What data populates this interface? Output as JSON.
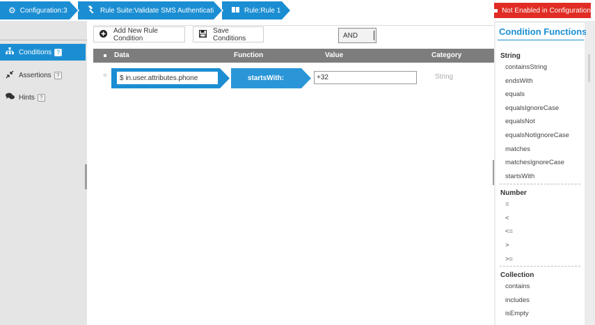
{
  "breadcrumbs": [
    {
      "label": "Configuration:3",
      "icon": "gear-icon"
    },
    {
      "label": "Rule Suite:Validate SMS Authentication",
      "icon": "gavel-icon"
    },
    {
      "label": "Rule:Rule 1",
      "icon": "book-icon"
    }
  ],
  "status_badge": {
    "label": "Not Enabled in Configuration",
    "color": "#e02c24"
  },
  "sidebar": {
    "items": [
      {
        "label": "Conditions",
        "icon": "sitemap-icon",
        "help": "?",
        "active": true
      },
      {
        "label": "Assertions",
        "icon": "compress-icon",
        "help": "?",
        "active": false
      },
      {
        "label": "Hints",
        "icon": "comments-icon",
        "help": "?",
        "active": false
      }
    ]
  },
  "toolbar": {
    "add_label": "Add New Rule Condition",
    "save_label": "Save Conditions",
    "logic_value": "AND"
  },
  "table": {
    "columns": [
      "Data",
      "Function",
      "Value",
      "Category"
    ],
    "rows": [
      {
        "data": "$ in.user.attributes.phone",
        "function": "startsWith:",
        "value": "+32",
        "category": "String"
      }
    ]
  },
  "functions_panel": {
    "title": "Condition Functions",
    "sections": [
      {
        "name": "String",
        "items": [
          "containsString",
          "endsWith",
          "equals",
          "equalsIgnoreCase",
          "equalsNot",
          "equalsNotIgnoreCase",
          "matches",
          "matchesIgnoreCase",
          "startsWith"
        ]
      },
      {
        "name": "Number",
        "items": [
          "=",
          "<",
          "<=",
          ">",
          ">="
        ]
      },
      {
        "name": "Collection",
        "items": [
          "contains",
          "includes",
          "isEmpty"
        ]
      }
    ]
  },
  "colors": {
    "accent": "#1b8ed3",
    "header_gray": "#7d7d7d",
    "sidebar_bg": "#e5e5e5",
    "error": "#e02c24"
  }
}
